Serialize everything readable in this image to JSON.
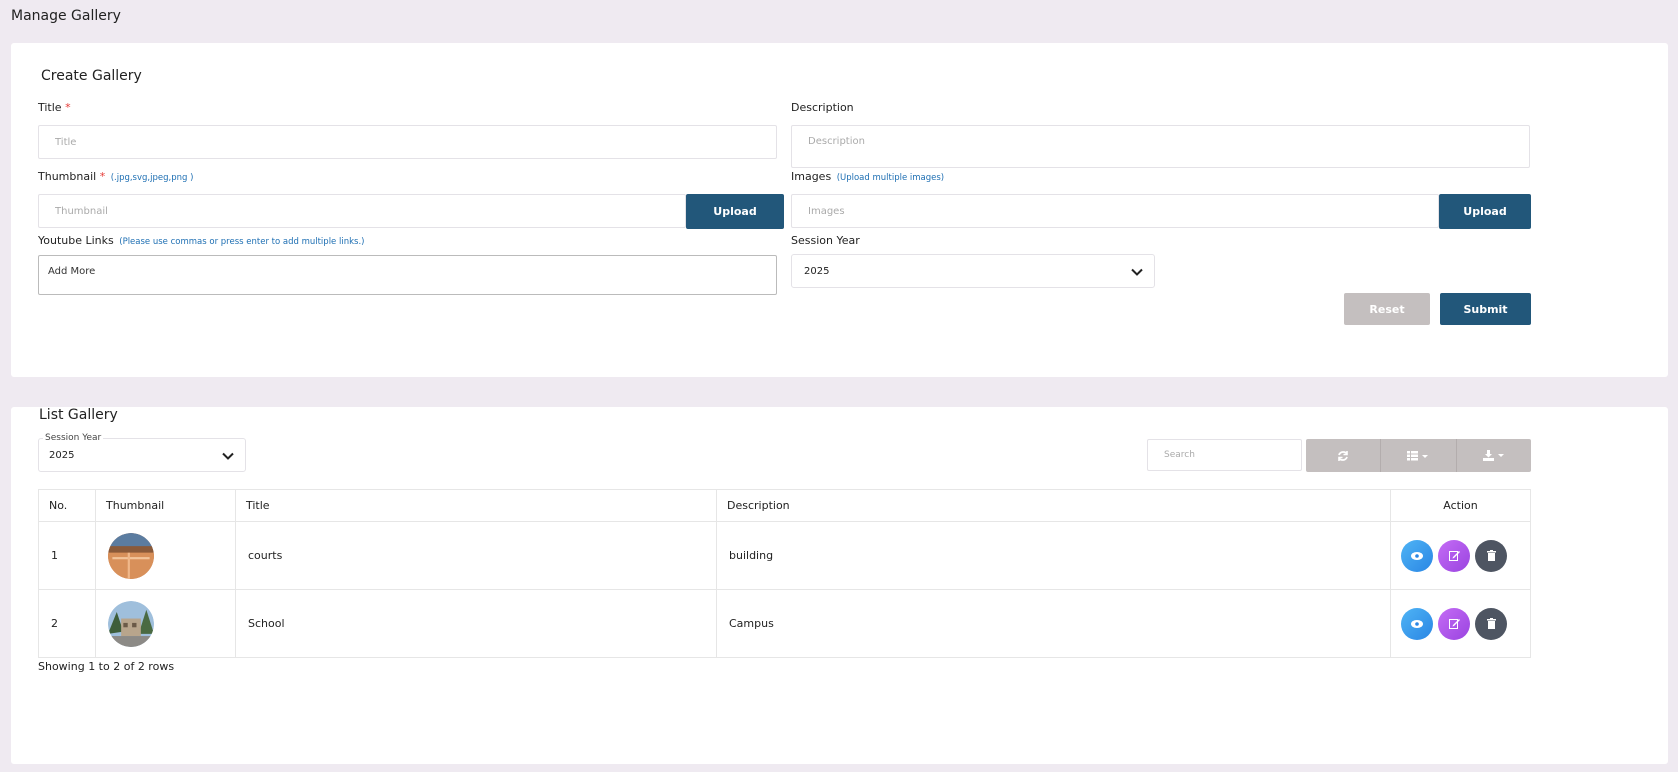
{
  "page_title": "Manage Gallery",
  "create": {
    "title": "Create Gallery",
    "title_label": "Title",
    "required_mark": "*",
    "title_placeholder": "Title",
    "description_label": "Description",
    "description_placeholder": "Description",
    "thumbnail_label": "Thumbnail",
    "thumbnail_hint": "(.jpg,svg,jpeg,png )",
    "thumbnail_placeholder": "Thumbnail",
    "images_label": "Images",
    "images_hint": "(Upload multiple images)",
    "images_placeholder": "Images",
    "upload_label": "Upload",
    "youtube_label": "Youtube Links",
    "youtube_hint": "(Please use commas or press enter to add multiple links.)",
    "youtube_placeholder": "Add More",
    "session_label": "Session Year",
    "session_value": "2025",
    "reset_label": "Reset",
    "submit_label": "Submit"
  },
  "list": {
    "title": "List Gallery",
    "session_label": "Session Year",
    "session_value": "2025",
    "search_placeholder": "Search",
    "toolbar_icons": [
      "refresh-icon",
      "columns-icon",
      "export-icon"
    ],
    "columns": [
      "No.",
      "Thumbnail",
      "Title",
      "Description",
      "Action"
    ],
    "rows": [
      {
        "no": "1",
        "title": "courts",
        "description": "building",
        "thumbnail": "courts-thumbnail"
      },
      {
        "no": "2",
        "title": "School",
        "description": "Campus",
        "thumbnail": "school-thumbnail"
      }
    ],
    "footer": "Showing 1 to 2 of 2 rows"
  },
  "colors": {
    "primary": "#22577a",
    "secondary": "#c4bfbf",
    "background": "#efeaf1",
    "required": "#e53935",
    "hint": "#1e6fb3"
  }
}
